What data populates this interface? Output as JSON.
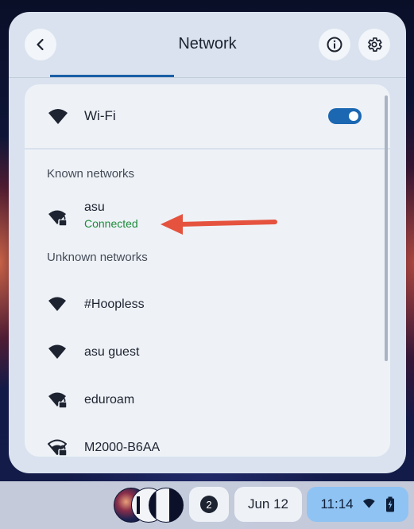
{
  "header": {
    "title": "Network",
    "back_icon": "arrow-back-icon",
    "info_icon": "info-icon",
    "settings_icon": "gear-icon"
  },
  "wifi": {
    "label": "Wi-Fi",
    "enabled": true
  },
  "known_networks": {
    "header": "Known networks",
    "items": [
      {
        "name": "asu",
        "status": "Connected",
        "secured": true
      }
    ]
  },
  "unknown_networks": {
    "header": "Unknown networks",
    "items": [
      {
        "name": "#Hoopless",
        "secured": false
      },
      {
        "name": "asu guest",
        "secured": false
      },
      {
        "name": "eduroam",
        "secured": true
      },
      {
        "name": "M2000-B6AA",
        "secured": true
      }
    ]
  },
  "shelf": {
    "notification_count": "2",
    "date": "Jun 12",
    "time": "11:14"
  },
  "colors": {
    "accent": "#1a5fa6",
    "connected": "#1d8a3a",
    "annotation_arrow": "#e5533f",
    "panel_bg": "#d9e2ee"
  }
}
